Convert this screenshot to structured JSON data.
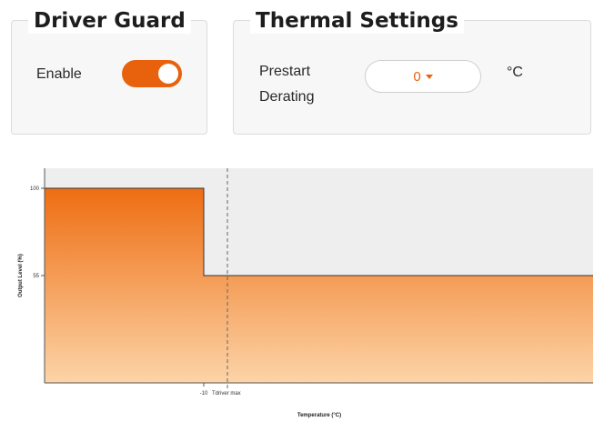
{
  "driver_guard": {
    "title": "Driver Guard",
    "enable_label": "Enable",
    "enabled": true,
    "accent": "#e8620e"
  },
  "thermal_settings": {
    "title": "Thermal Settings",
    "prestart_label_line1": "Prestart",
    "prestart_label_line2": "Derating",
    "prestart_value": "0",
    "unit": "°C"
  },
  "chart_data": {
    "type": "area",
    "xlabel": "Temperature (°C)",
    "ylabel": "Output Level (%)",
    "ylim": [
      0,
      110
    ],
    "y_ticks": [
      100,
      55
    ],
    "x_tick_label": "-10",
    "marker_label": "Tdriver max",
    "series": [
      {
        "values": [
          100,
          100,
          55,
          55
        ]
      }
    ],
    "step_x_label": "-10",
    "grid": false,
    "fill_top_color": "#ee6d12",
    "fill_bottom_color": "#fcd4a8"
  }
}
